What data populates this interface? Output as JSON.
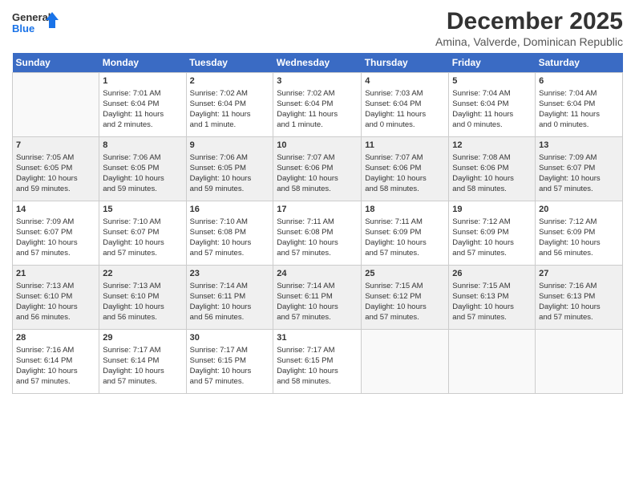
{
  "logo": {
    "general": "General",
    "blue": "Blue"
  },
  "title": "December 2025",
  "subtitle": "Amina, Valverde, Dominican Republic",
  "headers": [
    "Sunday",
    "Monday",
    "Tuesday",
    "Wednesday",
    "Thursday",
    "Friday",
    "Saturday"
  ],
  "weeks": [
    [
      {
        "day": "",
        "text": ""
      },
      {
        "day": "1",
        "text": "Sunrise: 7:01 AM\nSunset: 6:04 PM\nDaylight: 11 hours\nand 2 minutes."
      },
      {
        "day": "2",
        "text": "Sunrise: 7:02 AM\nSunset: 6:04 PM\nDaylight: 11 hours\nand 1 minute."
      },
      {
        "day": "3",
        "text": "Sunrise: 7:02 AM\nSunset: 6:04 PM\nDaylight: 11 hours\nand 1 minute."
      },
      {
        "day": "4",
        "text": "Sunrise: 7:03 AM\nSunset: 6:04 PM\nDaylight: 11 hours\nand 0 minutes."
      },
      {
        "day": "5",
        "text": "Sunrise: 7:04 AM\nSunset: 6:04 PM\nDaylight: 11 hours\nand 0 minutes."
      },
      {
        "day": "6",
        "text": "Sunrise: 7:04 AM\nSunset: 6:04 PM\nDaylight: 11 hours\nand 0 minutes."
      }
    ],
    [
      {
        "day": "7",
        "text": "Sunrise: 7:05 AM\nSunset: 6:05 PM\nDaylight: 10 hours\nand 59 minutes."
      },
      {
        "day": "8",
        "text": "Sunrise: 7:06 AM\nSunset: 6:05 PM\nDaylight: 10 hours\nand 59 minutes."
      },
      {
        "day": "9",
        "text": "Sunrise: 7:06 AM\nSunset: 6:05 PM\nDaylight: 10 hours\nand 59 minutes."
      },
      {
        "day": "10",
        "text": "Sunrise: 7:07 AM\nSunset: 6:06 PM\nDaylight: 10 hours\nand 58 minutes."
      },
      {
        "day": "11",
        "text": "Sunrise: 7:07 AM\nSunset: 6:06 PM\nDaylight: 10 hours\nand 58 minutes."
      },
      {
        "day": "12",
        "text": "Sunrise: 7:08 AM\nSunset: 6:06 PM\nDaylight: 10 hours\nand 58 minutes."
      },
      {
        "day": "13",
        "text": "Sunrise: 7:09 AM\nSunset: 6:07 PM\nDaylight: 10 hours\nand 57 minutes."
      }
    ],
    [
      {
        "day": "14",
        "text": "Sunrise: 7:09 AM\nSunset: 6:07 PM\nDaylight: 10 hours\nand 57 minutes."
      },
      {
        "day": "15",
        "text": "Sunrise: 7:10 AM\nSunset: 6:07 PM\nDaylight: 10 hours\nand 57 minutes."
      },
      {
        "day": "16",
        "text": "Sunrise: 7:10 AM\nSunset: 6:08 PM\nDaylight: 10 hours\nand 57 minutes."
      },
      {
        "day": "17",
        "text": "Sunrise: 7:11 AM\nSunset: 6:08 PM\nDaylight: 10 hours\nand 57 minutes."
      },
      {
        "day": "18",
        "text": "Sunrise: 7:11 AM\nSunset: 6:09 PM\nDaylight: 10 hours\nand 57 minutes."
      },
      {
        "day": "19",
        "text": "Sunrise: 7:12 AM\nSunset: 6:09 PM\nDaylight: 10 hours\nand 57 minutes."
      },
      {
        "day": "20",
        "text": "Sunrise: 7:12 AM\nSunset: 6:09 PM\nDaylight: 10 hours\nand 56 minutes."
      }
    ],
    [
      {
        "day": "21",
        "text": "Sunrise: 7:13 AM\nSunset: 6:10 PM\nDaylight: 10 hours\nand 56 minutes."
      },
      {
        "day": "22",
        "text": "Sunrise: 7:13 AM\nSunset: 6:10 PM\nDaylight: 10 hours\nand 56 minutes."
      },
      {
        "day": "23",
        "text": "Sunrise: 7:14 AM\nSunset: 6:11 PM\nDaylight: 10 hours\nand 56 minutes."
      },
      {
        "day": "24",
        "text": "Sunrise: 7:14 AM\nSunset: 6:11 PM\nDaylight: 10 hours\nand 57 minutes."
      },
      {
        "day": "25",
        "text": "Sunrise: 7:15 AM\nSunset: 6:12 PM\nDaylight: 10 hours\nand 57 minutes."
      },
      {
        "day": "26",
        "text": "Sunrise: 7:15 AM\nSunset: 6:13 PM\nDaylight: 10 hours\nand 57 minutes."
      },
      {
        "day": "27",
        "text": "Sunrise: 7:16 AM\nSunset: 6:13 PM\nDaylight: 10 hours\nand 57 minutes."
      }
    ],
    [
      {
        "day": "28",
        "text": "Sunrise: 7:16 AM\nSunset: 6:14 PM\nDaylight: 10 hours\nand 57 minutes."
      },
      {
        "day": "29",
        "text": "Sunrise: 7:17 AM\nSunset: 6:14 PM\nDaylight: 10 hours\nand 57 minutes."
      },
      {
        "day": "30",
        "text": "Sunrise: 7:17 AM\nSunset: 6:15 PM\nDaylight: 10 hours\nand 57 minutes."
      },
      {
        "day": "31",
        "text": "Sunrise: 7:17 AM\nSunset: 6:15 PM\nDaylight: 10 hours\nand 58 minutes."
      },
      {
        "day": "",
        "text": ""
      },
      {
        "day": "",
        "text": ""
      },
      {
        "day": "",
        "text": ""
      }
    ]
  ]
}
